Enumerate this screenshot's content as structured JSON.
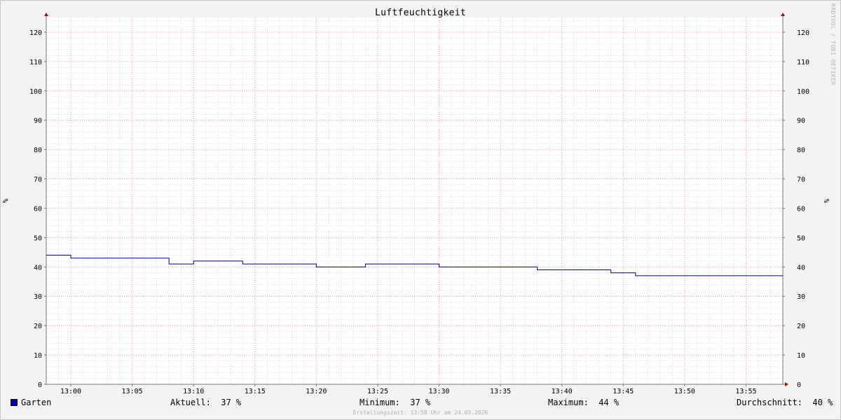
{
  "chart_data": {
    "type": "line",
    "title": "Luftfeuchtigkeit",
    "ylabel": "%",
    "ylabel_right": "%",
    "ylim": [
      0,
      125
    ],
    "yticks": [
      0,
      10,
      20,
      30,
      40,
      50,
      60,
      70,
      80,
      90,
      100,
      110,
      120
    ],
    "x_start": "12:58",
    "x_end": "13:58",
    "xticks": [
      "13:00",
      "13:05",
      "13:10",
      "13:15",
      "13:20",
      "13:25",
      "13:30",
      "13:35",
      "13:40",
      "13:45",
      "13:50",
      "13:55"
    ],
    "grid": true,
    "legend_position": "bottom-left",
    "series": [
      {
        "name": "Garten",
        "color": "#000080",
        "legend_color": "#0000aa",
        "step": true,
        "points": [
          {
            "x": "12:58",
            "y": 44
          },
          {
            "x": "13:00",
            "y": 43
          },
          {
            "x": "13:08",
            "y": 41
          },
          {
            "x": "13:10",
            "y": 42
          },
          {
            "x": "13:14",
            "y": 41
          },
          {
            "x": "13:20",
            "y": 40
          },
          {
            "x": "13:24",
            "y": 41
          },
          {
            "x": "13:30",
            "y": 40
          },
          {
            "x": "13:38",
            "y": 39
          },
          {
            "x": "13:44",
            "y": 38
          },
          {
            "x": "13:46",
            "y": 37
          },
          {
            "x": "13:58",
            "y": 37
          }
        ]
      }
    ]
  },
  "legend": {
    "series_name": "Garten",
    "current": "Aktuell:  37 %",
    "minimum": "Minimum:  37 %",
    "maximum": "Maximum:  44 %",
    "average": "Durchschnitt:  40 %"
  },
  "footer": "Erstellungszeit: 13:58 Uhr am 24.03.2026",
  "watermark": "RRDTOOL / TOBI OETIKER"
}
